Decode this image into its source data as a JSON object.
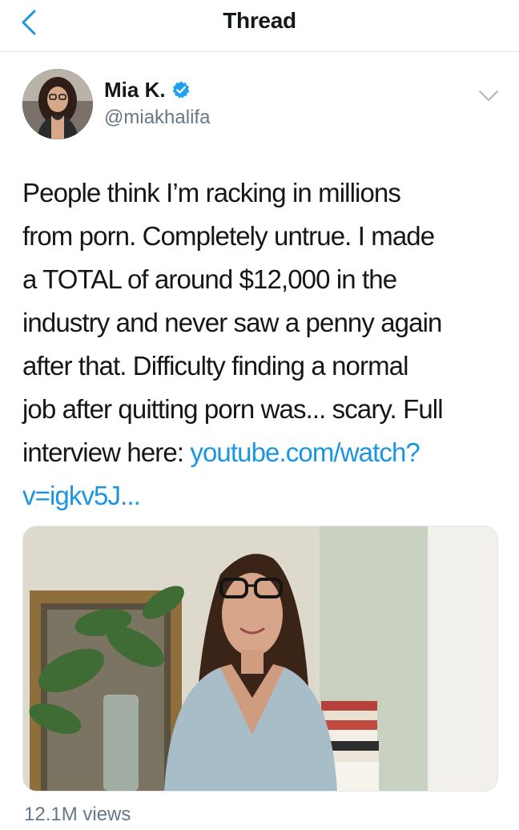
{
  "nav": {
    "title": "Thread",
    "back_icon": "chevron-left-icon"
  },
  "author": {
    "name": "Mia K.",
    "handle": "@miakhalifa",
    "verified": true,
    "verified_icon": "verified-badge-icon",
    "menu_icon": "chevron-down-icon"
  },
  "tweet": {
    "text_before_link": "People think I’m racking in millions\nfrom porn. Completely untrue. I made\na TOTAL of around $12,000 in the\nindustry and never saw a penny again\nafter that. Difficulty finding a normal\njob after quitting porn was... scary. Full\ninterview here: ",
    "link_text": "youtube.com/watch?\nv=igkv5J...",
    "views": "12.1M views"
  },
  "colors": {
    "accent": "#1b95e0",
    "text": "#14171a",
    "secondary": "#657786",
    "divider": "#d9dfe3"
  }
}
